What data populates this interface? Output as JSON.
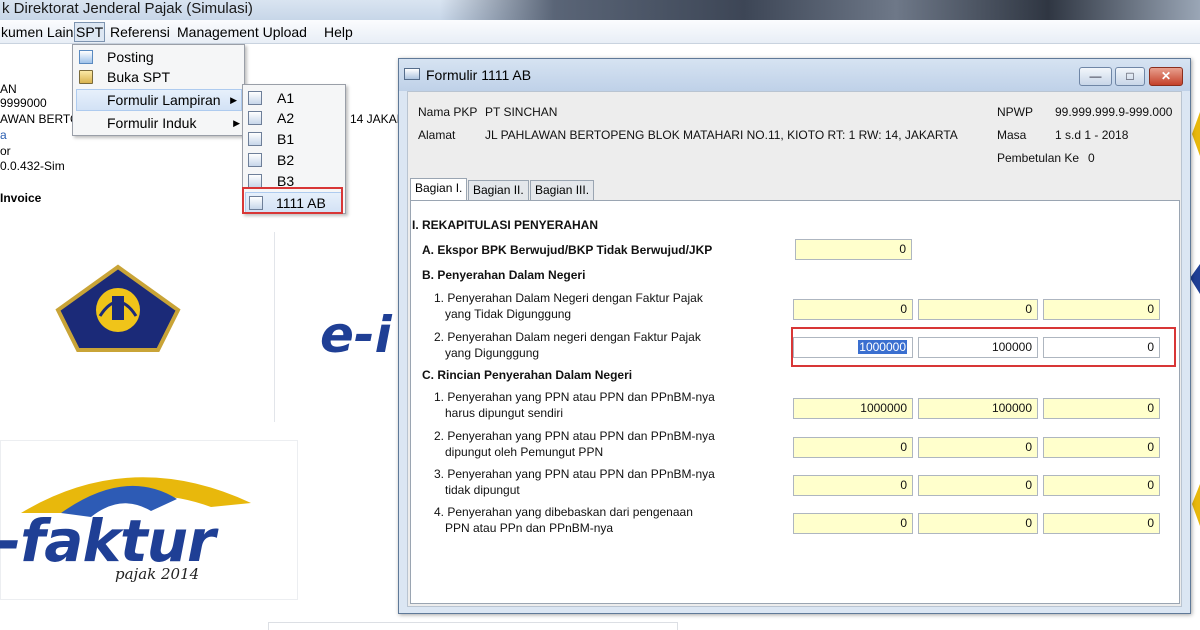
{
  "app": {
    "title": "k Direktorat Jenderal Pajak (Simulasi)"
  },
  "menubar": {
    "items": [
      {
        "label": "kumen Lain"
      },
      {
        "label": "SPT"
      },
      {
        "label": "Referensi"
      },
      {
        "label": "Management Upload"
      },
      {
        "label": "Help"
      }
    ]
  },
  "spt_menu": {
    "items": [
      {
        "label": "Posting",
        "icon": "posting-icon"
      },
      {
        "label": "Buka SPT",
        "icon": "folder-icon"
      },
      {
        "label": "Formulir Lampiran",
        "icon": "none",
        "submenu": true
      },
      {
        "label": "Formulir Induk",
        "icon": "none",
        "submenu": true
      }
    ]
  },
  "lampiran_submenu": {
    "items": [
      {
        "label": "A1"
      },
      {
        "label": "A2"
      },
      {
        "label": "B1"
      },
      {
        "label": "B2"
      },
      {
        "label": "B3"
      },
      {
        "label": "1111 AB"
      }
    ]
  },
  "background_info": {
    "line1": "AN",
    "line2": "9999000",
    "line3": "AWAN BERTO",
    "line4": "a",
    "line5": "or",
    "line6": "0.0.432-Sim",
    "invoice_label": "Invoice",
    "address_partial": "14 JAKAR"
  },
  "logos": {
    "efaktur_word": "-faktur",
    "efaktur_tagline": "pajak 2014",
    "efaktur_big_partial": "e-i"
  },
  "dialog": {
    "title": "Formulir 1111 AB",
    "buttons": {
      "minimize": "—",
      "maximize": "□",
      "close": "✕"
    },
    "header": {
      "nama_pkp_label": "Nama PKP",
      "nama_pkp_value": "PT SINCHAN",
      "alamat_label": "Alamat",
      "alamat_value": "JL PAHLAWAN BERTOPENG BLOK MATAHARI NO.11, KIOTO RT: 1 RW: 14, JAKARTA",
      "npwp_label": "NPWP",
      "npwp_value": "99.999.999.9-999.000",
      "masa_label": "Masa",
      "masa_value": "1 s.d 1 - 2018",
      "pembetulan_label": "Pembetulan Ke",
      "pembetulan_value": "0"
    },
    "tabs": [
      {
        "label": "Bagian I.",
        "selected": true
      },
      {
        "label": "Bagian II.",
        "selected": false
      },
      {
        "label": "Bagian III.",
        "selected": false
      }
    ],
    "section_title": "I. REKAPITULASI PENYERAHAN",
    "section_a": {
      "label": "A. Ekspor BPK Berwujud/BKP Tidak Berwujud/JKP",
      "value": "0"
    },
    "section_b": {
      "label": "B. Penyerahan Dalam Negeri",
      "rows": [
        {
          "line1": "1. Penyerahan Dalam Negeri dengan Faktur Pajak",
          "line2": "yang Tidak Digunggung",
          "values": [
            "0",
            "0",
            "0"
          ]
        },
        {
          "line1": "2. Penyerahan Dalam negeri dengan Faktur Pajak",
          "line2": "yang Digunggung",
          "values": [
            "1000000",
            "100000",
            "0"
          ]
        }
      ]
    },
    "section_c": {
      "label": "C. Rincian Penyerahan Dalam Negeri",
      "rows": [
        {
          "line1": "1. Penyerahan yang PPN atau PPN dan PPnBM-nya",
          "line2": "harus dipungut sendiri",
          "values": [
            "1000000",
            "100000",
            "0"
          ]
        },
        {
          "line1": "2. Penyerahan yang PPN atau PPN dan PPnBM-nya",
          "line2": "dipungut oleh Pemungut PPN",
          "values": [
            "0",
            "0",
            "0"
          ]
        },
        {
          "line1": "3. Penyerahan yang PPN atau PPN dan PPnBM-nya",
          "line2": "tidak dipungut",
          "values": [
            "0",
            "0",
            "0"
          ]
        },
        {
          "line1": "4. Penyerahan yang dibebaskan dari pengenaan",
          "line2": "PPN atau PPn dan PPnBM-nya",
          "values": [
            "0",
            "0",
            "0"
          ]
        }
      ]
    }
  },
  "colors": {
    "field_bg": "#ffffcc",
    "highlight_red": "#d83636",
    "selection_blue": "#3a6fd0",
    "window_frame": "#dbe6f3"
  }
}
